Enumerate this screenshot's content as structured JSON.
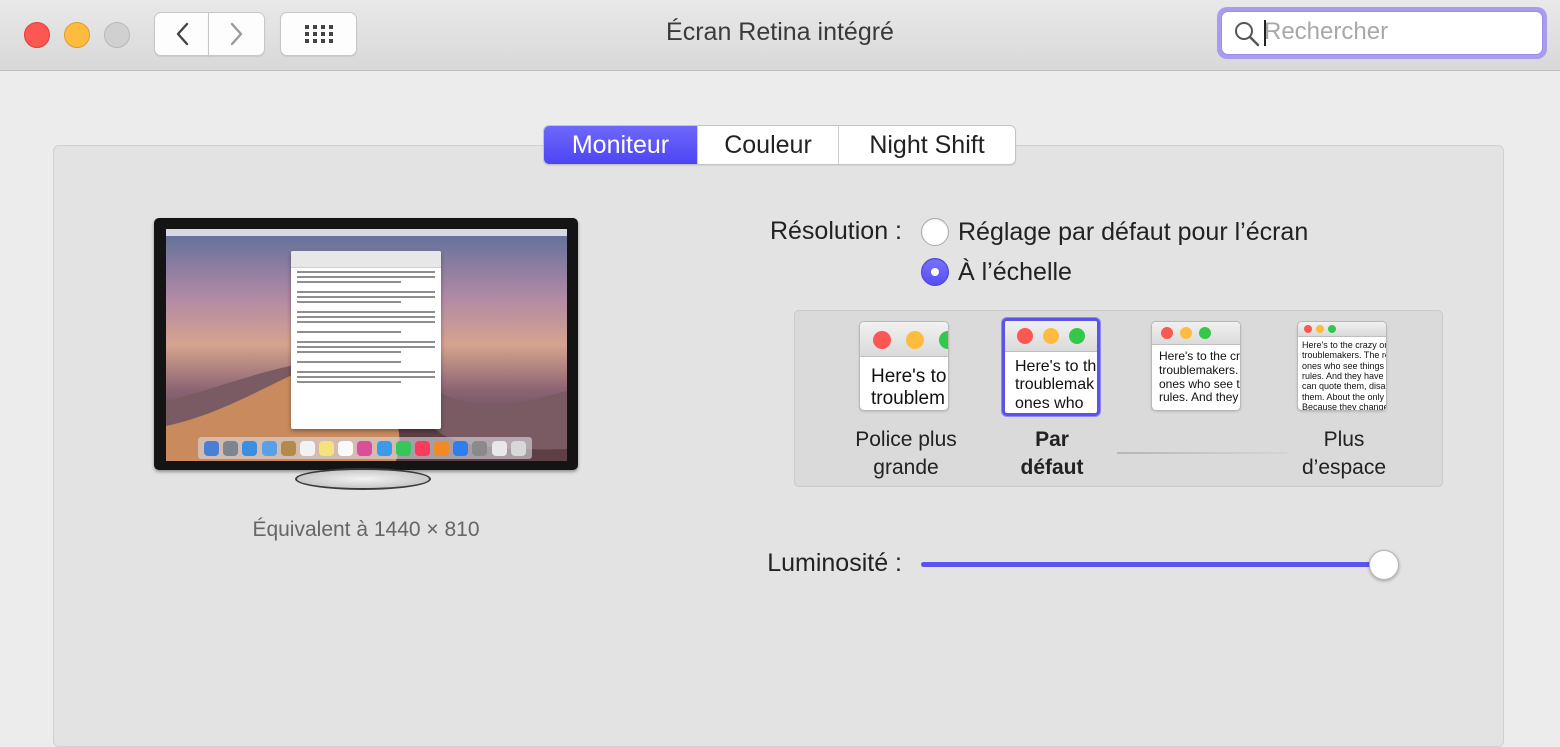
{
  "window": {
    "title": "Écran Retina intégré"
  },
  "search": {
    "placeholder": "Rechercher",
    "value": ""
  },
  "tabs": [
    {
      "label": "Moniteur",
      "active": true
    },
    {
      "label": "Couleur",
      "active": false
    },
    {
      "label": "Night Shift",
      "active": false
    }
  ],
  "monitor": {
    "equivalent": "Équivalent à 1440 × 810"
  },
  "resolution": {
    "label": "Résolution :",
    "options": [
      {
        "label": "Réglage par défaut pour l’écran",
        "selected": false
      },
      {
        "label": "À l’échelle",
        "selected": true
      }
    ],
    "scaled_options": [
      {
        "line1": "Police plus",
        "line2": "grande",
        "preview": [
          "Here's to",
          "troublem"
        ],
        "selected": false
      },
      {
        "line1": "Par",
        "line2": "défaut",
        "preview": [
          "Here's to th",
          "troublemak",
          "ones who"
        ],
        "selected": true
      },
      {
        "line1": "",
        "line2": "",
        "preview": [
          "Here's to the cr",
          "troublemakers.",
          "ones who see t",
          "rules. And they"
        ],
        "selected": false
      },
      {
        "line1": "Plus",
        "line2": "d’espace",
        "preview": [
          "Here's to the crazy one",
          "troublemakers. The rou",
          "ones who see things di",
          "rules. And they have no",
          "can quote them, disagre",
          "them. About the only th",
          "Because they change th"
        ],
        "selected": false
      }
    ]
  },
  "brightness": {
    "label": "Luminosité :",
    "level": 0.99
  },
  "colors": {
    "accent": "#5a53f0",
    "window_bg": "#ececec"
  }
}
